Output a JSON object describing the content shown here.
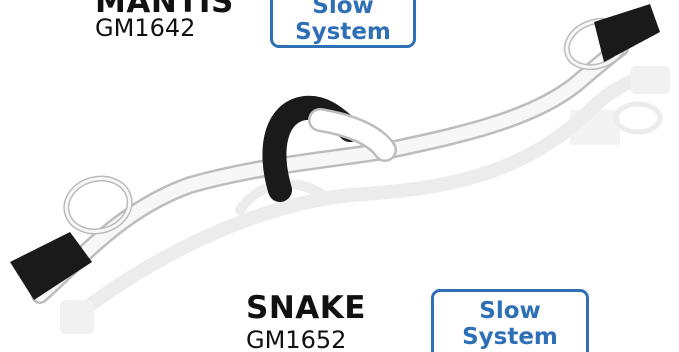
{
  "products": [
    {
      "name": "MANTIS",
      "code": "GM1642",
      "badge_line1": "Slow",
      "badge_line2": "System"
    },
    {
      "name": "SNAKE",
      "code": "GM1652",
      "badge_line1": "Slow",
      "badge_line2": "System"
    }
  ],
  "colors": {
    "badge": "#2f6fb6",
    "tip": "#1a1a1a",
    "wire": "#f4f4f4"
  }
}
